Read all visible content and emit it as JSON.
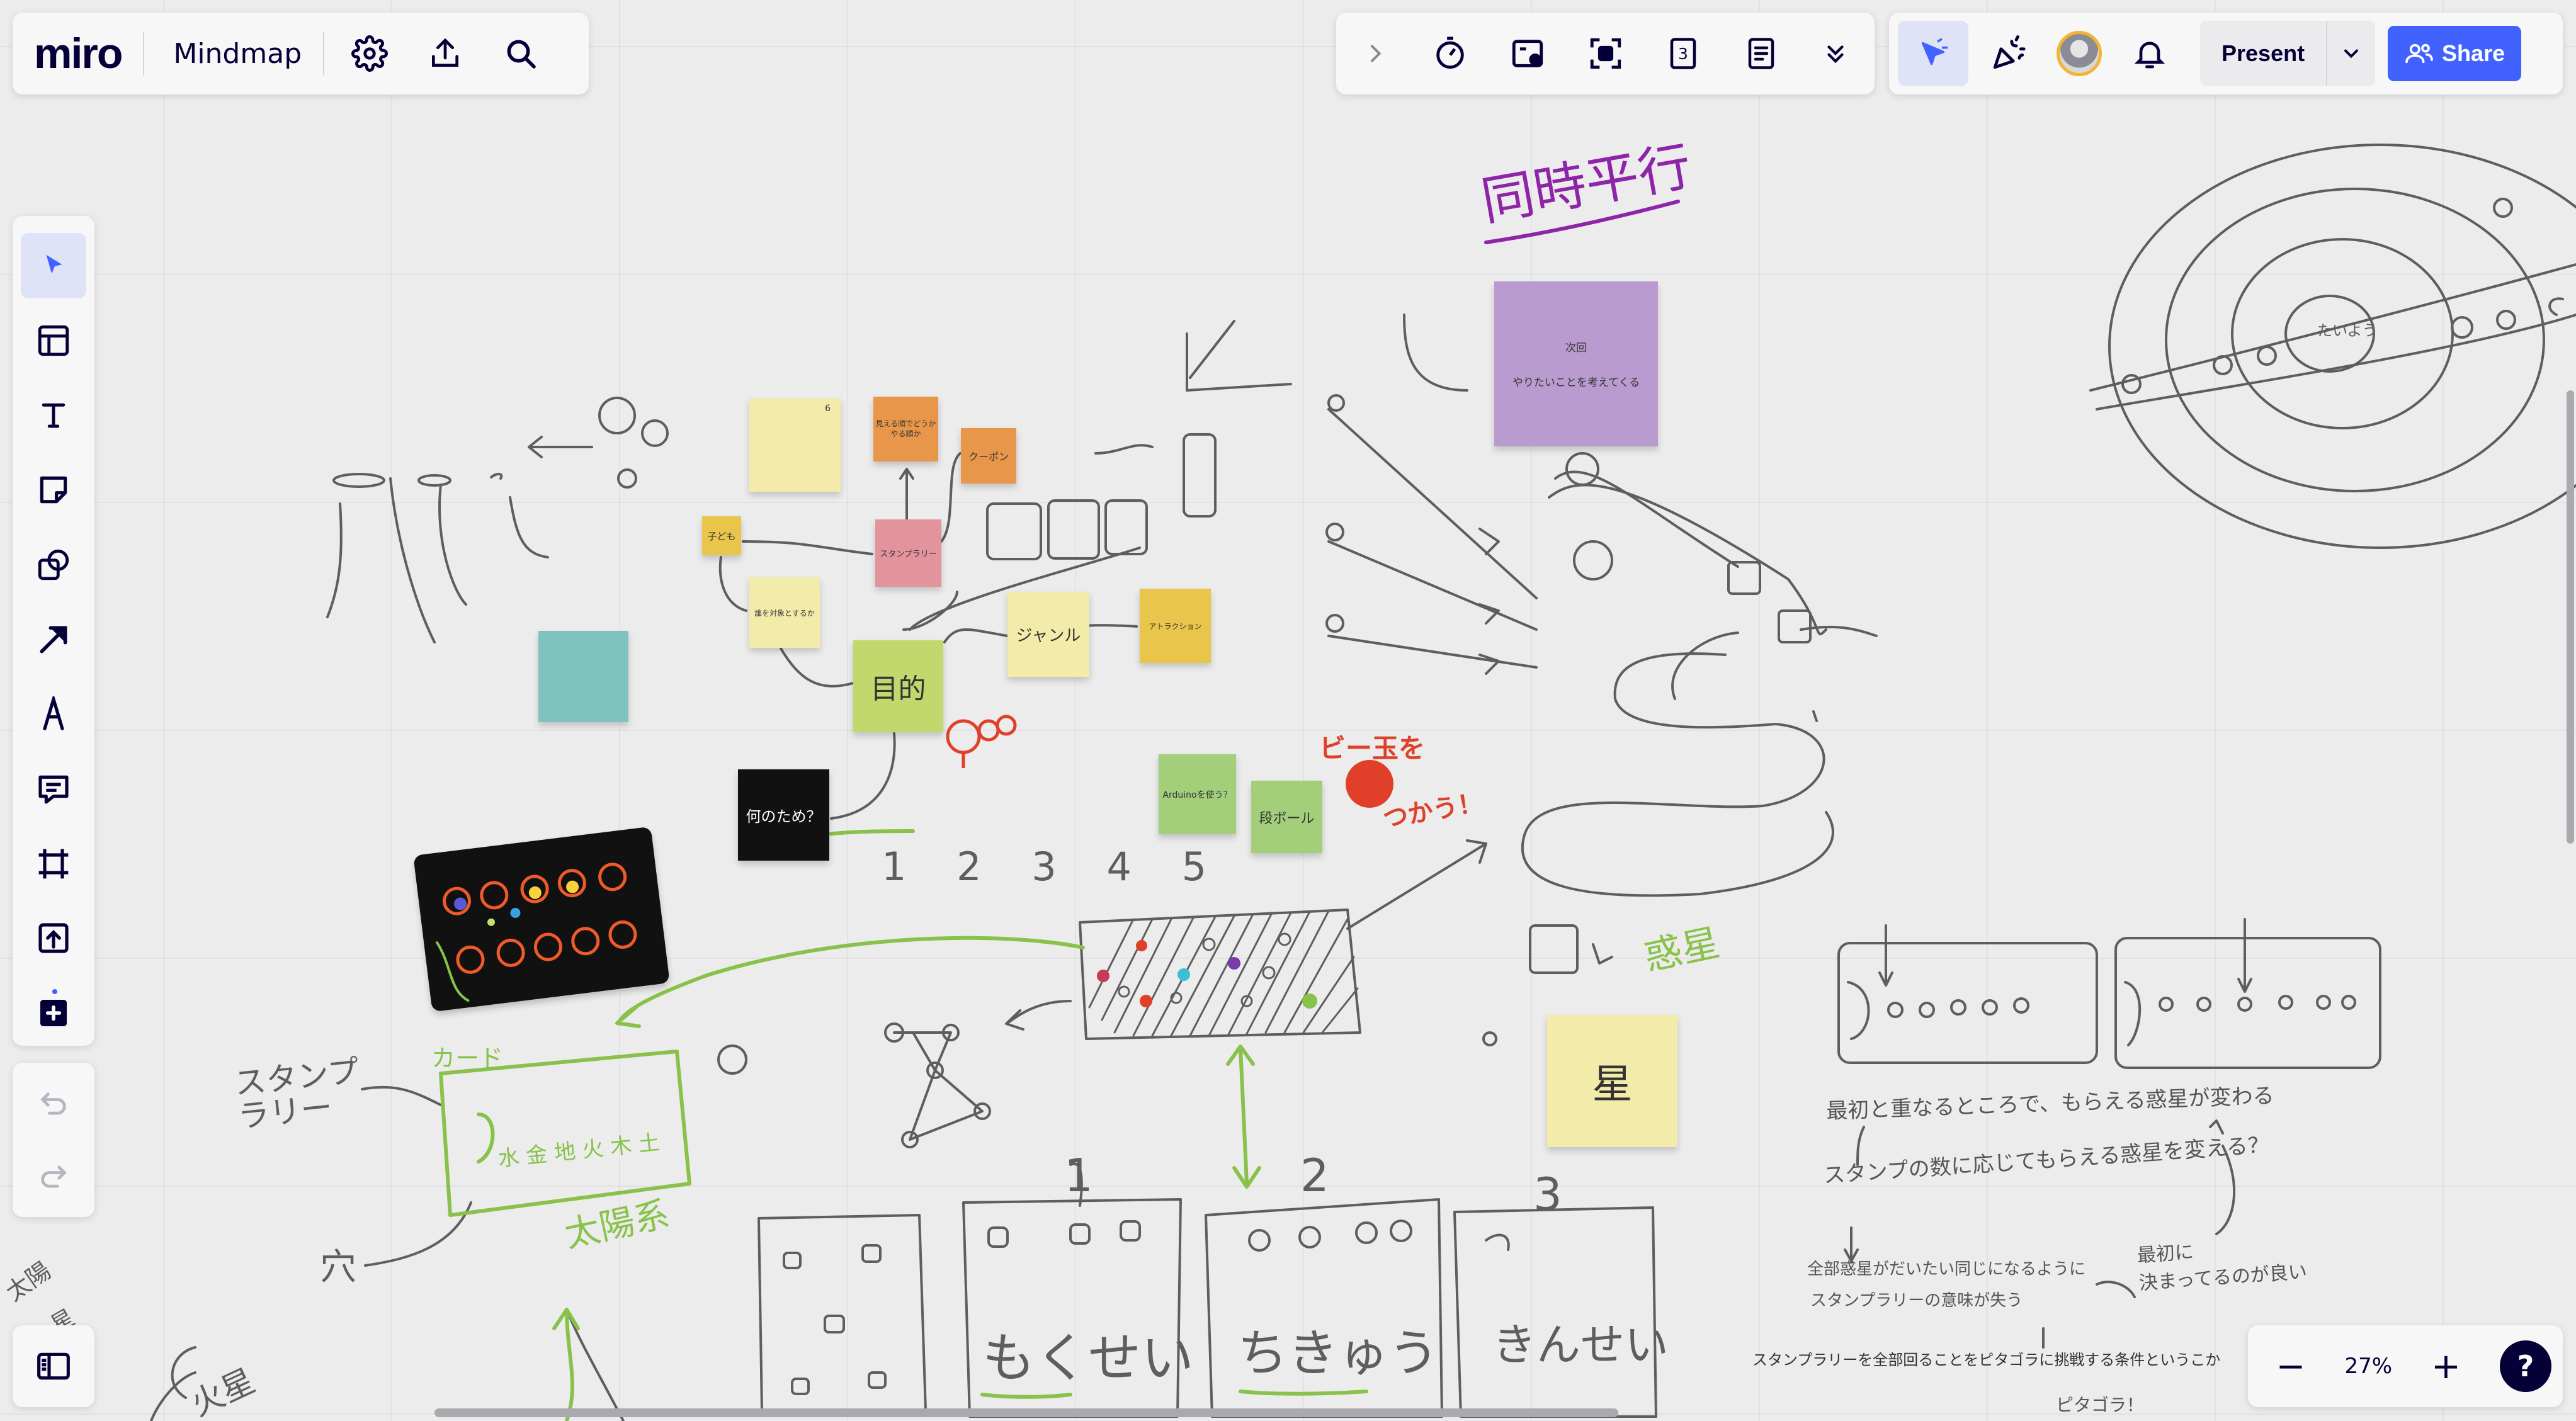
{
  "app": {
    "logo": "miro",
    "board_name": "Mindmap"
  },
  "top_right": {
    "present_label": "Present",
    "share_label": "Share",
    "timer_number": "3"
  },
  "zoom": {
    "level": "27%",
    "minus": "−",
    "plus": "+",
    "help": "?"
  },
  "notes": {
    "kodomo": "子ども",
    "stamp_rally": "スタンプラリー",
    "coupon": "クーポン",
    "target_q": "誰を対象とするか",
    "purpose": "目的",
    "genre": "ジャンル",
    "attraction": "アトラクション",
    "why": "何のため？",
    "arduino": "Arduinoを使う？",
    "cardboard": "段ボール",
    "star": "星",
    "purple_line1": "次回",
    "purple_line2": "やりたいことを考えてくる",
    "orange_small": "見える順でどうか\nやる順か",
    "yellow_marker": "6"
  },
  "handwriting": {
    "simultaneous": "同時平行",
    "marble": "ビー玉を",
    "use": "つかう！",
    "numbers": "1 2 3 4 5",
    "card": "カード",
    "stamp_label": "スタンプ\nラリー",
    "hole": "穴",
    "solar": "太陽系",
    "card_planets": "水 金 地 火 木 土",
    "pl_mokusei": "もくせい",
    "pl_chikyu": "ちきゅう",
    "pl_kinsei": "きんせい",
    "planet_right": "惑星",
    "n1": "1",
    "n2": "2",
    "n3": "3",
    "memo1": "最初と重なるところで、もらえる惑星が変わる",
    "memo2": "スタンプの数に応じてもらえる惑星を変える？",
    "memo3": "全部惑星がだいたい同じになるように",
    "memo4": "スタンプラリーの意味が失う",
    "memo5": "最初に\n決まってるのが良い",
    "memo6": "ピタゴラ！",
    "bottom_text": "スタンプラリーを全部回ることをピタゴラに挑戦する条件というこか",
    "left_edge1": "太陽",
    "left_edge2": "星",
    "left_edge3": "火星",
    "sun": "たいよう"
  },
  "icons": {
    "settings": "gear-icon",
    "export": "upload-icon",
    "search": "search-icon",
    "collapse": "chevron-right-icon",
    "timer": "timer-icon",
    "frame_select": "frame-icon",
    "focus": "focus-icon",
    "counter": "number-icon",
    "notes": "notes-icon",
    "more": "double-chevron-down-icon",
    "cursor_mode": "cursor-mode-icon",
    "reactions": "party-popper-icon",
    "avatar": "avatar-icon",
    "notifications": "bell-icon",
    "present_options": "chevron-down-icon",
    "share": "users-icon",
    "select": "pointer-icon",
    "templates": "templates-icon",
    "text": "text-icon",
    "sticky": "sticky-note-icon",
    "shapes": "shapes-icon",
    "connector": "arrow-icon",
    "pen": "pen-icon",
    "comment": "comment-icon",
    "frame": "frame-tool-icon",
    "upload": "upload-tool-icon",
    "more_apps": "plus-square-icon",
    "undo": "undo-icon",
    "redo": "redo-icon",
    "board_list": "sidebar-icon"
  },
  "colors": {
    "accent": "#4262ff",
    "canvas": "#ececec",
    "panel": "#f7f7f7",
    "sticky_yellow": "#f3ebaa",
    "sticky_orange": "#e8974a",
    "sticky_pink": "#e3939b",
    "sticky_lime": "#c2d86d",
    "sticky_green": "#a3cf7a",
    "sticky_gold": "#e9c64b",
    "sticky_teal": "#7fc2c0",
    "sticky_purple": "#b99bd0",
    "sticky_black": "#111111"
  }
}
